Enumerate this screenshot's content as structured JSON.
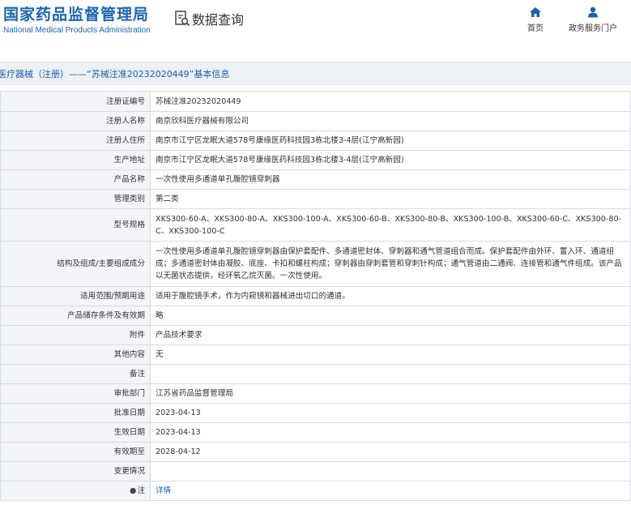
{
  "header": {
    "logo_cn": "国家药品监督管理局",
    "logo_en": "National Medical Products Administration",
    "query_title": "数据查询",
    "nav_home": "首页",
    "nav_portal": "政务服务门户"
  },
  "breadcrumb": "医疗器械（注册）——“苏械注准20232020449”基本信息",
  "colors": {
    "brand_blue": "#1a64b4",
    "label_bg": "#f3f5f8",
    "crumb_bg": "#edf0f4"
  },
  "rows": [
    {
      "label": "注册证编号",
      "value": "苏械注准20232020449"
    },
    {
      "label": "注册人名称",
      "value": "南京欣科医疗器械有限公司"
    },
    {
      "label": "注册人住所",
      "value": "南京市江宁区龙眠大道578号康缘医药科技园3栋北楼3-4层(江宁高新园)"
    },
    {
      "label": "生产地址",
      "value": "南京市江宁区龙眠大道578号康缘医药科技园3栋北楼3-4层(江宁高新园)"
    },
    {
      "label": "产品名称",
      "value": "一次性使用多通道单孔腹腔镜穿刺器"
    },
    {
      "label": "管理类别",
      "value": "第二类"
    },
    {
      "label": "型号规格",
      "value": "XKS300-60-A、XKS300-80-A、XKS300-100-A、XKS300-60-B、XKS300-80-B、XKS300-100-B、XKS300-60-C、XKS300-80-C、XKS300-100-C"
    },
    {
      "label": "结构及组成/主要组成成分",
      "value": "一次性使用多通道单孔腹腔镜穿刺器由保护套配件、多通道密封体、穿刺器和通气管道组合而成。保护套配件由外环、置入环、通道组成；多通道密封体由凝胶、底座、卡扣和螺柱构成；穿刺器由穿刺套管和穿刺针构成；通气管道由二通阀、连接管和通气件组成。该产品以无菌状态提供，经环氧乙烷灭菌。一次性使用。"
    },
    {
      "label": "适用范围/预期用途",
      "value": "适用于腹腔镜手术，作为内窥镜和器械进出切口的通道。"
    },
    {
      "label": "产品储存条件及有效期",
      "value": "略"
    },
    {
      "label": "附件",
      "value": "产品技术要求"
    },
    {
      "label": "其他内容",
      "value": "无"
    },
    {
      "label": "备注",
      "value": ""
    },
    {
      "label": "审批部门",
      "value": "江苏省药品监督管理局"
    },
    {
      "label": "批准日期",
      "value": "2023-04-13"
    },
    {
      "label": "生效日期",
      "value": "2023-04-13"
    },
    {
      "label": "有效期至",
      "value": "2028-04-12"
    },
    {
      "label": "变更情况",
      "value": ""
    },
    {
      "label": "注",
      "value": "详情"
    }
  ]
}
